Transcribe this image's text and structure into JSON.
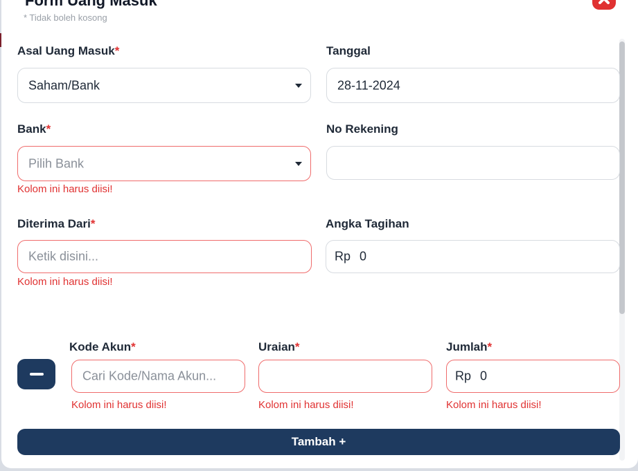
{
  "header": {
    "title": "Form Uang Masuk",
    "subtitle": "* Tidak boleh kosong"
  },
  "form": {
    "asal_uang_masuk": {
      "label": "Asal Uang Masuk",
      "required": "*",
      "value": "Saham/Bank"
    },
    "tanggal": {
      "label": "Tanggal",
      "value": "28-11-2024"
    },
    "bank": {
      "label": "Bank",
      "required": "*",
      "placeholder": "Pilih Bank",
      "error": "Kolom ini harus diisi!"
    },
    "no_rekening": {
      "label": "No Rekening",
      "value": ""
    },
    "diterima_dari": {
      "label": "Diterima Dari",
      "required": "*",
      "placeholder": "Ketik disini...",
      "error": "Kolom ini harus diisi!"
    },
    "angka_tagihan": {
      "label": "Angka Tagihan",
      "prefix": "Rp",
      "value": "0"
    }
  },
  "rows": [
    {
      "kode_akun": {
        "label": "Kode Akun",
        "required": "*",
        "placeholder": "Cari Kode/Nama Akun...",
        "error": "Kolom ini harus diisi!"
      },
      "uraian": {
        "label": "Uraian",
        "required": "*",
        "value": "",
        "error": "Kolom ini harus diisi!"
      },
      "jumlah": {
        "label": "Jumlah",
        "required": "*",
        "prefix": "Rp",
        "value": "0",
        "error": "Kolom ini harus diisi!"
      }
    }
  ],
  "actions": {
    "add_label": "Tambah +"
  },
  "colors": {
    "primary": "#1e3a5f",
    "danger": "#e03131",
    "error_border": "#ef6b6b"
  }
}
